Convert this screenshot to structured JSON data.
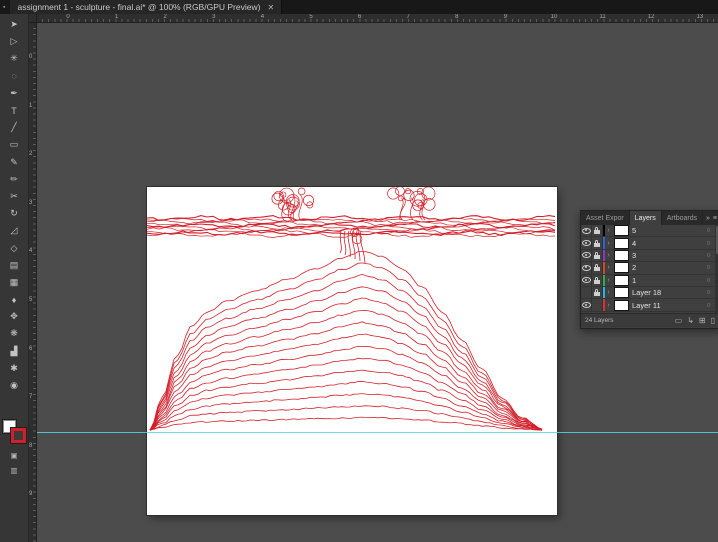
{
  "window": {
    "app_icon_glyph": "▪",
    "tab_title": "assignment 1 - sculpture - final.ai* @ 100% (RGB/GPU Preview)",
    "close_glyph": "✕"
  },
  "rulers": {
    "top_numbers": [
      "0",
      "1",
      "2",
      "3",
      "4",
      "5",
      "6",
      "7",
      "8",
      "9",
      "10",
      "11",
      "12",
      "13"
    ],
    "left_numbers": [
      "0",
      "1",
      "2",
      "3",
      "4",
      "5",
      "6",
      "7",
      "8",
      "9"
    ]
  },
  "toolbar": {
    "tools": [
      {
        "name": "selection-tool",
        "glyph": "➤"
      },
      {
        "name": "direct-selection-tool",
        "glyph": "▷"
      },
      {
        "name": "magic-wand-tool",
        "glyph": "✳"
      },
      {
        "name": "lasso-tool",
        "glyph": "◌"
      },
      {
        "name": "pen-tool",
        "glyph": "✒"
      },
      {
        "name": "type-tool",
        "glyph": "T"
      },
      {
        "name": "line-segment-tool",
        "glyph": "╱"
      },
      {
        "name": "rectangle-tool",
        "glyph": "▭"
      },
      {
        "name": "paintbrush-tool",
        "glyph": "✎"
      },
      {
        "name": "pencil-tool",
        "glyph": "✏"
      },
      {
        "name": "scissors-tool",
        "glyph": "✂"
      },
      {
        "name": "rotate-tool",
        "glyph": "↻"
      },
      {
        "name": "scale-tool",
        "glyph": "◿"
      },
      {
        "name": "width-tool",
        "glyph": "◇"
      },
      {
        "name": "gradient-tool",
        "glyph": "▤"
      },
      {
        "name": "mesh-tool",
        "glyph": "▦"
      },
      {
        "name": "eyedropper-tool",
        "glyph": "♦"
      },
      {
        "name": "blend-tool",
        "glyph": "✥"
      },
      {
        "name": "symbol-sprayer-tool",
        "glyph": "❋"
      },
      {
        "name": "column-graph-tool",
        "glyph": "▟"
      },
      {
        "name": "hand-tool",
        "glyph": "✱"
      },
      {
        "name": "zoom-tool",
        "glyph": "◉"
      }
    ],
    "modes": [
      {
        "name": "draw-mode-button",
        "glyph": "▣"
      },
      {
        "name": "screen-mode-button",
        "glyph": "▥"
      }
    ]
  },
  "canvas": {
    "guide_color": "#58d5e6"
  },
  "artwork": {
    "stroke": "#d2202a",
    "contours": 15
  },
  "layers_panel": {
    "tabs": [
      {
        "label": "Asset Expor"
      },
      {
        "label": "Layers"
      },
      {
        "label": "Artboards"
      }
    ],
    "collapse_glyph": "»",
    "menu_glyph": "≡",
    "chevron_glyph": "›",
    "target_glyph": "○",
    "rows": [
      {
        "name": "5",
        "color": "#000000",
        "eye": true,
        "lock": true
      },
      {
        "name": "4",
        "color": "#2f62d8",
        "eye": true,
        "lock": true
      },
      {
        "name": "3",
        "color": "#8b36c9",
        "eye": true,
        "lock": true
      },
      {
        "name": "2",
        "color": "#d8452c",
        "eye": true,
        "lock": true
      },
      {
        "name": "1",
        "color": "#2fae49",
        "eye": true,
        "lock": true
      },
      {
        "name": "Layer 18",
        "color": "#27b4e8",
        "eye": false,
        "lock": true
      },
      {
        "name": "Layer 11",
        "color": "#e03131",
        "eye": true,
        "lock": false
      }
    ],
    "status": "24 Layers",
    "footer_icons": [
      {
        "name": "make-clipping-mask-button",
        "glyph": "▭"
      },
      {
        "name": "new-sublayer-button",
        "glyph": "↳"
      },
      {
        "name": "new-layer-button",
        "glyph": "⊞"
      },
      {
        "name": "delete-layer-button",
        "glyph": "▯"
      }
    ]
  }
}
